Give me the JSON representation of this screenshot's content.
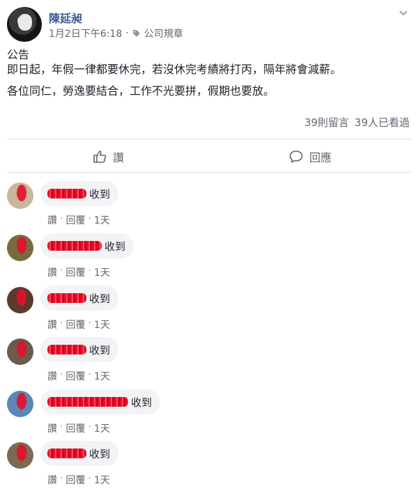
{
  "post": {
    "author": "陳延昶",
    "date": "1月2日下午6:18",
    "dot": "·",
    "group": "公司規章",
    "lines": [
      "公告",
      "即日起，年假一律都要休完，若沒休完考績將打丙，隔年將會減薪。",
      "各位同仁，勞逸要結合，工作不光要拼，假期也要放。"
    ],
    "stats": {
      "comments": "39則留言",
      "views": "39人已看過"
    }
  },
  "actions": {
    "like": "讚",
    "comment": "回應"
  },
  "comments": [
    {
      "text": "收到",
      "like": "讚",
      "reply": "回覆",
      "time": "1天",
      "avatar_color": "#c9b79a"
    },
    {
      "text": "收到",
      "like": "讚",
      "reply": "回覆",
      "time": "1天",
      "avatar_color": "#7a6a3f"
    },
    {
      "text": "收到",
      "like": "讚",
      "reply": "回覆",
      "time": "1天",
      "avatar_color": "#5b3b2e"
    },
    {
      "text": "收到",
      "like": "讚",
      "reply": "回覆",
      "time": "1天",
      "avatar_color": "#6d5a4d"
    },
    {
      "text": "收到",
      "like": "讚",
      "reply": "回覆",
      "time": "1天",
      "avatar_color": "#5d86b8"
    },
    {
      "text": "收到",
      "like": "讚",
      "reply": "回覆",
      "time": "1天",
      "avatar_color": "#7b6b54"
    }
  ],
  "separator": "·",
  "colors": {
    "name_link": "#385898",
    "meta_gray": "#616770",
    "bubble_bg": "#f2f3f5",
    "redaction": "#e3102a"
  }
}
